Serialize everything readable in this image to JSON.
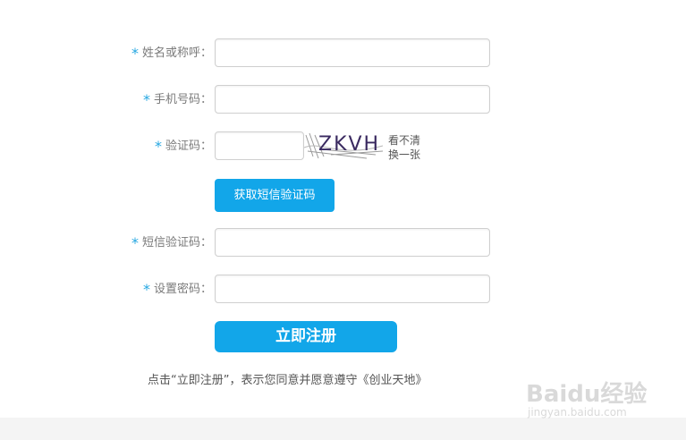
{
  "form": {
    "name_label": "姓名或称呼：",
    "phone_label": "手机号码：",
    "captcha_label": "验证码：",
    "captcha_text": "ZKVH",
    "captcha_refresh_line1": "看不清",
    "captcha_refresh_line2": "换一张",
    "sms_button": "获取短信验证码",
    "sms_code_label": "短信验证码：",
    "password_label": "设置密码：",
    "submit_button": "立即注册",
    "required_mark": "*"
  },
  "agreement_text": "点击“立即注册”，表示您同意并愿意遵守《创业天地》",
  "watermark": {
    "logo": "Baidu经验",
    "url": "jingyan.baidu.com"
  },
  "colors": {
    "accent": "#12a6e9",
    "required": "#25a7e1"
  }
}
